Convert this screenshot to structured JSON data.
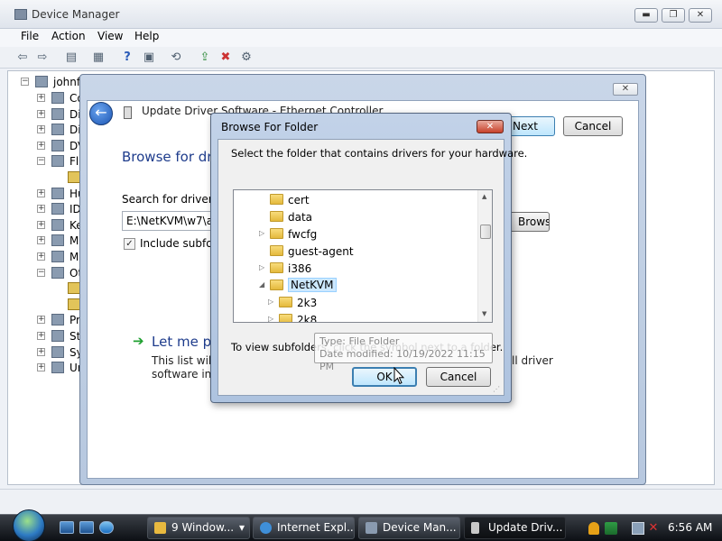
{
  "device_manager": {
    "title": "Device Manager",
    "caption": {
      "minimize": "▬",
      "maximize": "❐",
      "close": "✕"
    },
    "menu": [
      "File",
      "Action",
      "View",
      "Help"
    ],
    "tree": {
      "root": "johnf",
      "items": [
        {
          "label": "Co",
          "expander": "+"
        },
        {
          "label": "Di",
          "expander": "+"
        },
        {
          "label": "Di",
          "expander": "+"
        },
        {
          "label": "DV",
          "expander": "+"
        },
        {
          "label": "Fl",
          "expander": "−"
        },
        {
          "label": "",
          "expander": ""
        },
        {
          "label": "Hu",
          "expander": "+"
        },
        {
          "label": "ID",
          "expander": "+"
        },
        {
          "label": "Ke",
          "expander": "+"
        },
        {
          "label": "M",
          "expander": "+"
        },
        {
          "label": "M",
          "expander": "+"
        },
        {
          "label": "Ot",
          "expander": "−"
        },
        {
          "label": "",
          "expander": ""
        },
        {
          "label": "",
          "expander": ""
        },
        {
          "label": "Pr",
          "expander": "+"
        },
        {
          "label": "St",
          "expander": "+"
        },
        {
          "label": "Sy",
          "expander": "+"
        },
        {
          "label": "Ur",
          "expander": "+"
        }
      ]
    }
  },
  "wizard": {
    "title_text": "Update Driver Software - Ethernet Controller",
    "close": "✕",
    "heading": "Browse for dri",
    "search_label": "Search for driver so",
    "path_value": "E:\\NetKVM\\w7\\ar",
    "browse_label": "Browse...",
    "include_label": "Include subfold",
    "include_checked": "✓",
    "letme_label": "Let me pi",
    "desc_line1": "This list will s",
    "desc_line2": "software in t",
    "desc_tail": "ll driver",
    "next_label": "Next",
    "cancel_label": "Cancel"
  },
  "browse_dialog": {
    "title": "Browse For Folder",
    "close": "✕",
    "prompt": "Select the folder that contains drivers for your hardware.",
    "folders": [
      {
        "name": "cert",
        "twisty": ""
      },
      {
        "name": "data",
        "twisty": ""
      },
      {
        "name": "fwcfg",
        "twisty": "▷"
      },
      {
        "name": "guest-agent",
        "twisty": ""
      },
      {
        "name": "i386",
        "twisty": "▷"
      },
      {
        "name": "NetKVM",
        "twisty": "◢"
      },
      {
        "name": "2k3",
        "twisty": "▷"
      },
      {
        "name": "2k8",
        "twisty": "▷"
      }
    ],
    "selected_folder": "NetKVM",
    "help_text": "To view subfolders, click the symbol next to a folder.",
    "tooltip_line1": "Type: File Folder",
    "tooltip_line2": "Date modified: 10/19/2022 11:15 PM",
    "ok_label": "OK",
    "cancel_label": "Cancel"
  },
  "taskbar": {
    "buttons": [
      {
        "label": "9 Window...",
        "arrow": "▾",
        "active": false
      },
      {
        "label": "Internet Expl...",
        "active": false
      },
      {
        "label": "Device Man...",
        "active": false
      },
      {
        "label": "Update Driv...",
        "active": true
      }
    ],
    "clock": "6:56 AM"
  },
  "colors": {
    "link_blue": "#1e3c8c",
    "accent_green": "#1fa030",
    "selection": "#cce8ff"
  }
}
